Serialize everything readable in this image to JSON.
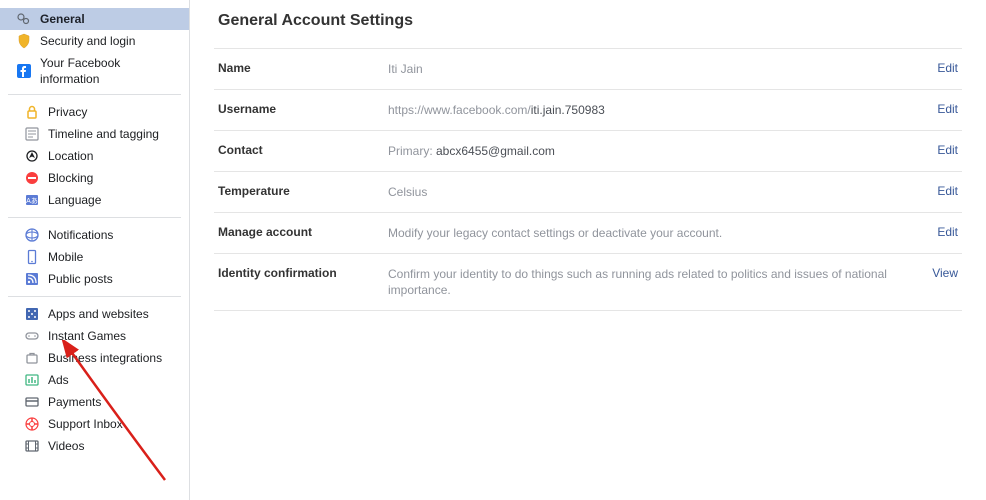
{
  "page_title": "General Account Settings",
  "sidebar": {
    "groups": [
      [
        {
          "label": "General",
          "active": true
        },
        {
          "label": "Security and login"
        },
        {
          "label": "Your Facebook information"
        }
      ],
      [
        {
          "label": "Privacy"
        },
        {
          "label": "Timeline and tagging"
        },
        {
          "label": "Location"
        },
        {
          "label": "Blocking"
        },
        {
          "label": "Language"
        }
      ],
      [
        {
          "label": "Notifications"
        },
        {
          "label": "Mobile"
        },
        {
          "label": "Public posts"
        }
      ],
      [
        {
          "label": "Apps and websites"
        },
        {
          "label": "Instant Games"
        },
        {
          "label": "Business integrations"
        },
        {
          "label": "Ads"
        },
        {
          "label": "Payments"
        },
        {
          "label": "Support Inbox"
        },
        {
          "label": "Videos"
        }
      ]
    ]
  },
  "settings": [
    {
      "label": "Name",
      "value": "Iti Jain",
      "action": "Edit"
    },
    {
      "label": "Username",
      "value_prefix": "https://www.facebook.com/",
      "value_highlight": "iti.jain.750983",
      "action": "Edit"
    },
    {
      "label": "Contact",
      "value_prefix": "Primary: ",
      "value_highlight": "abcx6455@gmail.com",
      "action": "Edit"
    },
    {
      "label": "Temperature",
      "value": "Celsius",
      "action": "Edit"
    },
    {
      "label": "Manage account",
      "value": "Modify your legacy contact settings or deactivate your account.",
      "action": "Edit"
    },
    {
      "label": "Identity confirmation",
      "value": "Confirm your identity to do things such as running ads related to politics and issues of national importance.",
      "action": "View"
    }
  ]
}
